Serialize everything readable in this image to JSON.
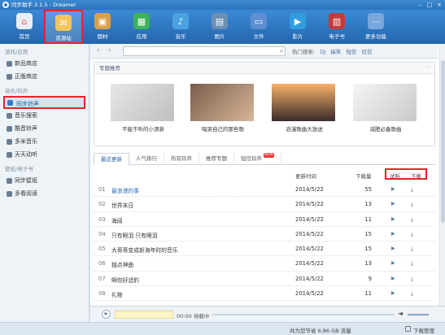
{
  "window": {
    "title": "同步助手 2.1.5 - Dreamer"
  },
  "toolbar": {
    "items": [
      {
        "label": "首页",
        "icon": "home-icon"
      },
      {
        "label": "资源站",
        "icon": "envelope-icon"
      },
      {
        "label": "题材",
        "icon": "box-icon"
      },
      {
        "label": "应用",
        "icon": "apps-icon"
      },
      {
        "label": "音乐",
        "icon": "music-icon"
      },
      {
        "label": "图片",
        "icon": "picture-icon"
      },
      {
        "label": "文件",
        "icon": "folder-icon"
      },
      {
        "label": "影片",
        "icon": "film-icon"
      },
      {
        "label": "电子书",
        "icon": "book-icon"
      },
      {
        "label": "更多功能",
        "icon": "more-icon"
      }
    ]
  },
  "sidebar": {
    "groups": [
      {
        "label": "游戏/应用",
        "items": [
          "新品商店",
          "正版商店"
        ]
      },
      {
        "label": "音乐/铃声",
        "items": [
          "同步铃声",
          "音乐搜索",
          "酷音铃声",
          "多米音乐",
          "天天动听"
        ]
      },
      {
        "label": "壁纸/电子书",
        "items": [
          "同步壁纸",
          "多看阅读"
        ]
      }
    ]
  },
  "nav": {
    "search_placeholder": "",
    "hot_label": "热门搜索:",
    "hot_terms": [
      "DJ",
      "搞笑",
      "短信",
      "炫信"
    ]
  },
  "feature": {
    "title": "专题推荐",
    "albums": [
      {
        "caption": "不能不听的小清新"
      },
      {
        "caption": "唱哭自己的那些歌"
      },
      {
        "caption": "浪漫歌曲大放送"
      },
      {
        "caption": "减肥必备歌曲"
      }
    ]
  },
  "tabs": [
    "最近更新",
    "人气排行",
    "所有铃声",
    "推荐专题",
    "短信铃声"
  ],
  "tab_new_badge": "NEW",
  "list": {
    "headers": {
      "time": "更新时间",
      "count": "下载量",
      "play": "试听",
      "download": "下载"
    },
    "rows": [
      {
        "num": "01",
        "title": "最浪漫的事",
        "date": "2014/5/22",
        "count": "55"
      },
      {
        "num": "02",
        "title": "世界末日",
        "date": "2014/5/22",
        "count": "13"
      },
      {
        "num": "03",
        "title": "海阔",
        "date": "2014/5/22",
        "count": "11"
      },
      {
        "num": "04",
        "title": "只有眼泪 只有眼泪",
        "date": "2014/5/22",
        "count": "15"
      },
      {
        "num": "05",
        "title": "大哥哥变成新海年时的音乐",
        "date": "2014/5/22",
        "count": "15"
      },
      {
        "num": "06",
        "title": "独点神曲",
        "date": "2014/5/22",
        "count": "13"
      },
      {
        "num": "07",
        "title": "啊你好滤豹",
        "date": "2014/5/22",
        "count": "9"
      },
      {
        "num": "08",
        "title": "礼物",
        "date": "2014/5/22",
        "count": "11"
      }
    ]
  },
  "player": {
    "time": "00:00",
    "status": "待载中"
  },
  "status_bar": {
    "saved": "共为您节省 6.86 GB 流量",
    "download_mgr": "下载管理"
  },
  "colors": {
    "accent": "#2c73bb",
    "highlight": "#e42626"
  }
}
